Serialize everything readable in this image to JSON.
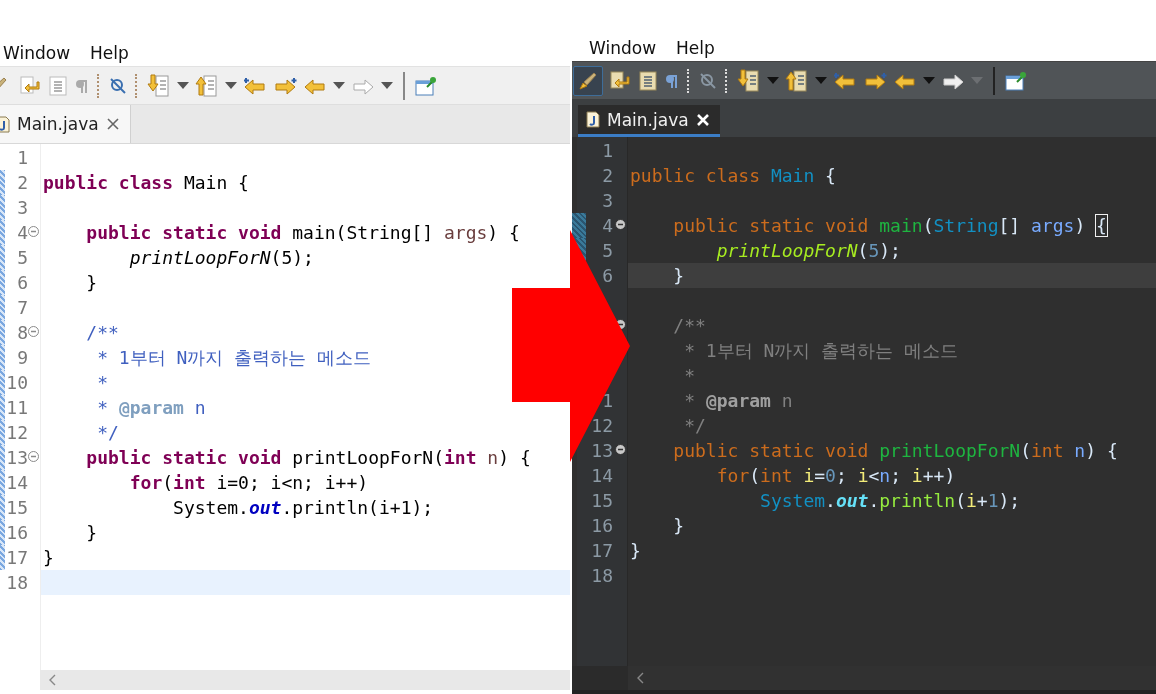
{
  "panels": [
    {
      "kind": "light",
      "menu": [
        {
          "label": "Window"
        },
        {
          "label": "Help"
        }
      ],
      "tab": {
        "label": "Main.java",
        "selected": true
      },
      "lines": [
        {
          "number": "1",
          "fold": false,
          "current": false,
          "changed": false
        },
        {
          "number": "2",
          "fold": false,
          "current": false,
          "changed": true,
          "tokens": [
            {
              "text": "public class",
              "kind": "kw"
            },
            {
              "text": " Main {",
              "kind": "plain"
            }
          ]
        },
        {
          "number": "3",
          "fold": false,
          "current": false,
          "changed": true
        },
        {
          "number": "4",
          "fold": true,
          "current": false,
          "changed": true,
          "tokens": [
            {
              "text": "    public static void",
              "kind": "kw"
            },
            {
              "text": " main(String[] ",
              "kind": "plain"
            },
            {
              "text": "args",
              "kind": "param"
            },
            {
              "text": ") {",
              "kind": "plain"
            }
          ]
        },
        {
          "number": "5",
          "fold": false,
          "current": false,
          "changed": true,
          "tokens": [
            {
              "text": "        printLoopForN",
              "kind": "call"
            },
            {
              "text": "(5);",
              "kind": "plain"
            }
          ]
        },
        {
          "number": "6",
          "fold": false,
          "current": false,
          "changed": true,
          "tokens": [
            {
              "text": "    }",
              "kind": "plain"
            }
          ]
        },
        {
          "number": "7",
          "fold": false,
          "current": false,
          "changed": true
        },
        {
          "number": "8",
          "fold": true,
          "current": false,
          "changed": true,
          "tokens": [
            {
              "text": "    /**",
              "kind": "doc"
            }
          ]
        },
        {
          "number": "9",
          "fold": false,
          "current": false,
          "changed": true,
          "tokens": [
            {
              "text": "     * 1부터 N까지 출력하는 메소드",
              "kind": "doc"
            }
          ]
        },
        {
          "number": "10",
          "fold": false,
          "current": false,
          "changed": true,
          "tokens": [
            {
              "text": "     *",
              "kind": "doc"
            }
          ]
        },
        {
          "number": "11",
          "fold": false,
          "current": false,
          "changed": true,
          "tokens": [
            {
              "text": "     * ",
              "kind": "doc"
            },
            {
              "text": "@param",
              "kind": "tag"
            },
            {
              "text": " n",
              "kind": "doc"
            }
          ]
        },
        {
          "number": "12",
          "fold": false,
          "current": false,
          "changed": true,
          "tokens": [
            {
              "text": "     */",
              "kind": "doc"
            }
          ]
        },
        {
          "number": "13",
          "fold": true,
          "current": false,
          "changed": true,
          "tokens": [
            {
              "text": "    public static void",
              "kind": "kw"
            },
            {
              "text": " printLoopForN(",
              "kind": "plain"
            },
            {
              "text": "int",
              "kind": "kw"
            },
            {
              "text": " n",
              "kind": "param"
            },
            {
              "text": ") {",
              "kind": "plain"
            }
          ]
        },
        {
          "number": "14",
          "fold": false,
          "current": false,
          "changed": true,
          "tokens": [
            {
              "text": "        for",
              "kind": "kw"
            },
            {
              "text": "(",
              "kind": "plain"
            },
            {
              "text": "int",
              "kind": "kw"
            },
            {
              "text": " i=0; i<n; i++)",
              "kind": "plain"
            }
          ]
        },
        {
          "number": "15",
          "fold": false,
          "current": false,
          "changed": true,
          "tokens": [
            {
              "text": "            System.",
              "kind": "plain"
            },
            {
              "text": "out",
              "kind": "field"
            },
            {
              "text": ".println(i+1);",
              "kind": "plain"
            }
          ]
        },
        {
          "number": "16",
          "fold": false,
          "current": false,
          "changed": true,
          "tokens": [
            {
              "text": "    }",
              "kind": "plain"
            }
          ]
        },
        {
          "number": "17",
          "fold": false,
          "current": false,
          "changed": true,
          "tokens": [
            {
              "text": "}",
              "kind": "plain"
            }
          ]
        },
        {
          "number": "18",
          "fold": false,
          "current": true,
          "changed": false
        }
      ]
    },
    {
      "kind": "dark",
      "menu": [
        {
          "label": "Window"
        },
        {
          "label": "Help"
        }
      ],
      "tab": {
        "label": "Main.java",
        "selected": true
      },
      "lines": [
        {
          "number": "1",
          "fold": false,
          "current": false,
          "changed": false
        },
        {
          "number": "2",
          "fold": false,
          "current": false,
          "changed": false,
          "tokens": [
            {
              "text": "public class",
              "kind": "kw"
            },
            {
              "text": " Main",
              "kind": "cls"
            },
            {
              "text": " {",
              "kind": "plain"
            }
          ]
        },
        {
          "number": "3",
          "fold": false,
          "current": false,
          "changed": false
        },
        {
          "number": "4",
          "fold": true,
          "current": false,
          "changed": true,
          "tokens": [
            {
              "text": "    public static void",
              "kind": "kw"
            },
            {
              "text": " main",
              "kind": "decl"
            },
            {
              "text": "(",
              "kind": "plain"
            },
            {
              "text": "String",
              "kind": "cls"
            },
            {
              "text": "[] ",
              "kind": "plain"
            },
            {
              "text": "args",
              "kind": "param"
            },
            {
              "text": ") ",
              "kind": "plain"
            },
            {
              "text": "{",
              "kind": "match"
            }
          ]
        },
        {
          "number": "5",
          "fold": false,
          "current": false,
          "changed": true,
          "tokens": [
            {
              "text": "        printLoopForN",
              "kind": "call"
            },
            {
              "text": "(",
              "kind": "plain"
            },
            {
              "text": "5",
              "kind": "num"
            },
            {
              "text": ");",
              "kind": "plain"
            }
          ]
        },
        {
          "number": "6",
          "fold": false,
          "current": true,
          "changed": false,
          "tokens": [
            {
              "text": "    }",
              "kind": "plain"
            }
          ]
        },
        {
          "fold": false,
          "current": false,
          "changed": false
        },
        {
          "fold": true,
          "current": false,
          "changed": false,
          "tokens": [
            {
              "text": "    /**",
              "kind": "doc"
            }
          ]
        },
        {
          "fold": false,
          "current": false,
          "changed": false,
          "tokens": [
            {
              "text": "     * 1부터 N까지 출력하는 메소드",
              "kind": "doc"
            }
          ]
        },
        {
          "fold": false,
          "current": false,
          "changed": false,
          "tokens": [
            {
              "text": "     *",
              "kind": "doc"
            }
          ]
        },
        {
          "number": "1",
          "fold": false,
          "current": false,
          "changed": false,
          "tokens": [
            {
              "text": "     * ",
              "kind": "doc"
            },
            {
              "text": "@param",
              "kind": "tag"
            },
            {
              "text": " n",
              "kind": "doc"
            }
          ]
        },
        {
          "number": "12",
          "fold": false,
          "current": false,
          "changed": false,
          "tokens": [
            {
              "text": "     */",
              "kind": "doc"
            }
          ]
        },
        {
          "number": "13",
          "fold": true,
          "current": false,
          "changed": false,
          "tokens": [
            {
              "text": "    public static void",
              "kind": "kw"
            },
            {
              "text": " printLoopForN",
              "kind": "decl"
            },
            {
              "text": "(",
              "kind": "plain"
            },
            {
              "text": "int",
              "kind": "kw"
            },
            {
              "text": " n",
              "kind": "param"
            },
            {
              "text": ") {",
              "kind": "plain"
            }
          ]
        },
        {
          "number": "14",
          "fold": false,
          "current": false,
          "changed": false,
          "tokens": [
            {
              "text": "        for",
              "kind": "kw"
            },
            {
              "text": "(",
              "kind": "plain"
            },
            {
              "text": "int",
              "kind": "kw"
            },
            {
              "text": " i",
              "kind": "local"
            },
            {
              "text": "=",
              "kind": "plain"
            },
            {
              "text": "0",
              "kind": "num"
            },
            {
              "text": "; ",
              "kind": "plain"
            },
            {
              "text": "i",
              "kind": "local"
            },
            {
              "text": "<",
              "kind": "plain"
            },
            {
              "text": "n",
              "kind": "param"
            },
            {
              "text": "; ",
              "kind": "plain"
            },
            {
              "text": "i",
              "kind": "local"
            },
            {
              "text": "++)",
              "kind": "plain"
            }
          ]
        },
        {
          "number": "15",
          "fold": false,
          "current": false,
          "changed": false,
          "tokens": [
            {
              "text": "            System",
              "kind": "cls"
            },
            {
              "text": ".",
              "kind": "plain"
            },
            {
              "text": "out",
              "kind": "field"
            },
            {
              "text": ".",
              "kind": "plain"
            },
            {
              "text": "println",
              "kind": "mcall"
            },
            {
              "text": "(",
              "kind": "plain"
            },
            {
              "text": "i",
              "kind": "local"
            },
            {
              "text": "+",
              "kind": "plain"
            },
            {
              "text": "1",
              "kind": "num"
            },
            {
              "text": ");",
              "kind": "plain"
            }
          ]
        },
        {
          "number": "16",
          "fold": false,
          "current": false,
          "changed": false,
          "tokens": [
            {
              "text": "    }",
              "kind": "plain"
            }
          ]
        },
        {
          "number": "17",
          "fold": false,
          "current": false,
          "changed": false,
          "tokens": [
            {
              "text": "}",
              "kind": "plain"
            }
          ]
        },
        {
          "number": "18",
          "fold": false,
          "current": false,
          "changed": false
        }
      ]
    }
  ]
}
